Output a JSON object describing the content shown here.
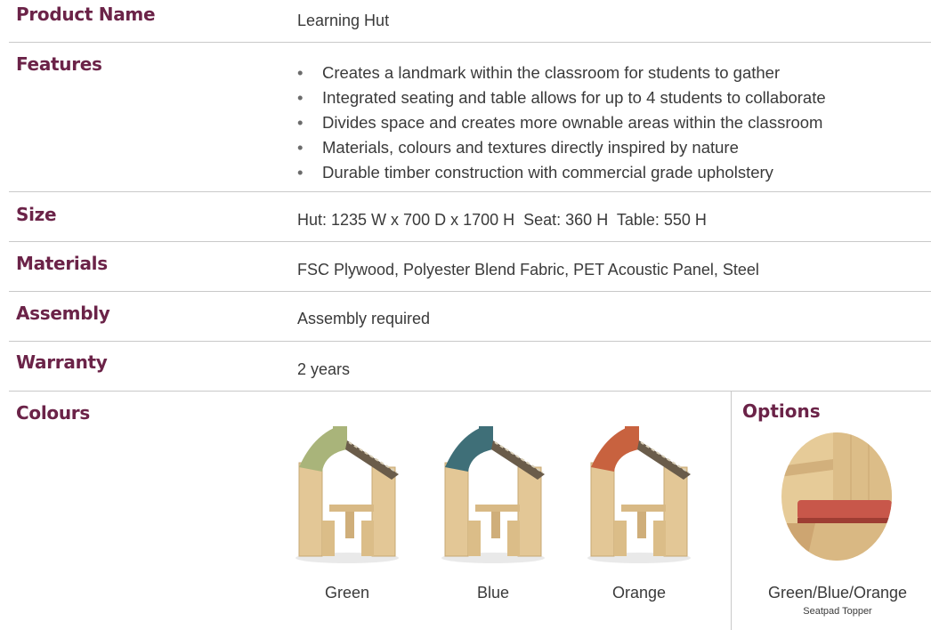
{
  "rows": {
    "product_name": {
      "label": "Product Name",
      "value": "Learning Hut"
    },
    "features": {
      "label": "Features",
      "bullet": "•",
      "items": [
        "Creates a landmark within the classroom for students to gather",
        "Integrated seating and table allows for up to 4 students to collaborate",
        "Divides space and creates more ownable areas within the classroom",
        "Materials, colours and textures directly inspired by nature",
        "Durable timber construction with commercial grade upholstery"
      ]
    },
    "size": {
      "label": "Size",
      "value": "Hut: 1235 W x 700 D x 1700 H  Seat: 360 H  Table: 550 H"
    },
    "materials": {
      "label": "Materials",
      "value": "FSC Plywood, Polyester Blend Fabric, PET Acoustic Panel, Steel"
    },
    "assembly": {
      "label": "Assembly",
      "value": "Assembly required"
    },
    "warranty": {
      "label": "Warranty",
      "value": "2 years"
    }
  },
  "colours": {
    "label": "Colours",
    "swatches": [
      {
        "name": "Green",
        "color": "#a9b47a"
      },
      {
        "name": "Blue",
        "color": "#3f6f78"
      },
      {
        "name": "Orange",
        "color": "#c8623f"
      }
    ]
  },
  "options": {
    "title": "Options",
    "label": "Green/Blue/Orange",
    "sublabel": "Seatpad Topper",
    "seat_color": "#c8574a"
  },
  "theme": {
    "accent": "#6b2348",
    "timber": "#e3c796",
    "rule": "#c9c9c9"
  }
}
